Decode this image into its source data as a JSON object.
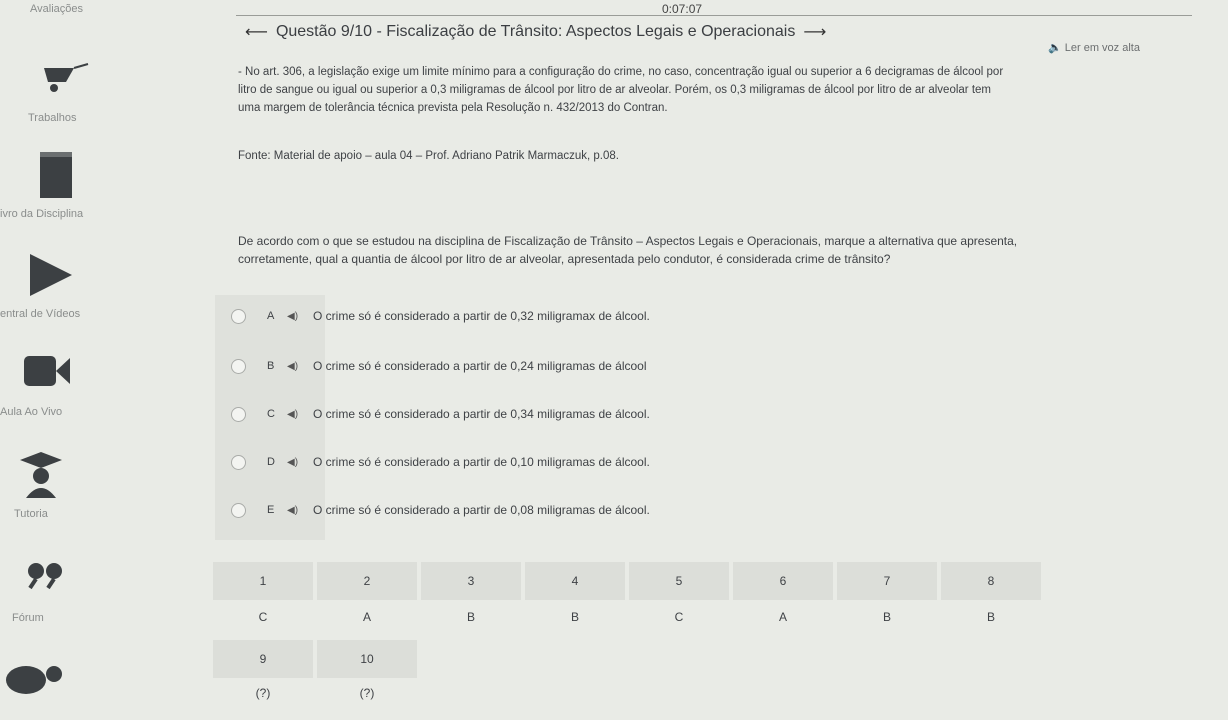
{
  "timer": "0:07:07",
  "sidebar": {
    "items": [
      {
        "label": "Avaliações",
        "icon": "gradebook-icon"
      },
      {
        "label": "Trabalhos",
        "icon": "wheelbarrow-icon"
      },
      {
        "label": "ivro da Disciplina",
        "icon": "book-icon"
      },
      {
        "label": "entral de Vídeos",
        "icon": "play-icon"
      },
      {
        "label": "Aula Ao Vivo",
        "icon": "video-camera-icon"
      },
      {
        "label": "Tutoria",
        "icon": "graduate-icon"
      },
      {
        "label": "Fórum",
        "icon": "quote-icon"
      },
      {
        "label": "",
        "icon": "chat-icon"
      }
    ]
  },
  "header": {
    "title": "Questão 9/10 - Fiscalização de Trânsito: Aspectos Legais e Operacionais",
    "listen": "Ler em voz alta"
  },
  "body": {
    "para_lines": [
      "- No art. 306, a legislação exige um limite mínimo para a configuração do crime, no caso, concentração igual ou superior a 6 decigramas de álcool por",
      "litro de sangue ou igual ou superior a 0,3 miligramas de álcool por litro de ar alveolar. Porém, os 0,3 miligramas de álcool por litro de ar alveolar tem",
      "uma margem de tolerância técnica prevista pela Resolução n. 432/2013 do Contran."
    ],
    "source": "Fonte: Material de apoio – aula 04 – Prof. Adriano Patrik Marmaczuk, p.08.",
    "question_lines": [
      "De acordo com o que se estudou na disciplina de Fiscalização de Trânsito – Aspectos Legais e Operacionais, marque a alternativa que apresenta,",
      "corretamente, qual a quantia de álcool por litro de ar alveolar, apresentada pelo condutor, é considerada crime de trânsito?"
    ]
  },
  "options": [
    {
      "letter": "A",
      "text": "O crime só é considerado a partir de 0,32 miligramax de álcool."
    },
    {
      "letter": "B",
      "text": "O crime só é considerado a partir de 0,24 miligramas de álcool"
    },
    {
      "letter": "C",
      "text": "O crime só é considerado a partir de 0,34 miligramas de álcool."
    },
    {
      "letter": "D",
      "text": "O crime só é considerado a partir de 0,10 miligramas de álcool."
    },
    {
      "letter": "E",
      "text": "O crime só é considerado a partir de 0,08 miligramas de álcool."
    }
  ],
  "answer_grid": [
    {
      "num": "1",
      "ans": "C"
    },
    {
      "num": "2",
      "ans": "A"
    },
    {
      "num": "3",
      "ans": "B"
    },
    {
      "num": "4",
      "ans": "B"
    },
    {
      "num": "5",
      "ans": "C"
    },
    {
      "num": "6",
      "ans": "A"
    },
    {
      "num": "7",
      "ans": "B"
    },
    {
      "num": "8",
      "ans": "B"
    },
    {
      "num": "9",
      "ans": "(?)"
    },
    {
      "num": "10",
      "ans": "(?)"
    }
  ],
  "colors": {
    "background": "#e9ebe6",
    "icon": "#3c4043",
    "cell": "#dcded9"
  }
}
